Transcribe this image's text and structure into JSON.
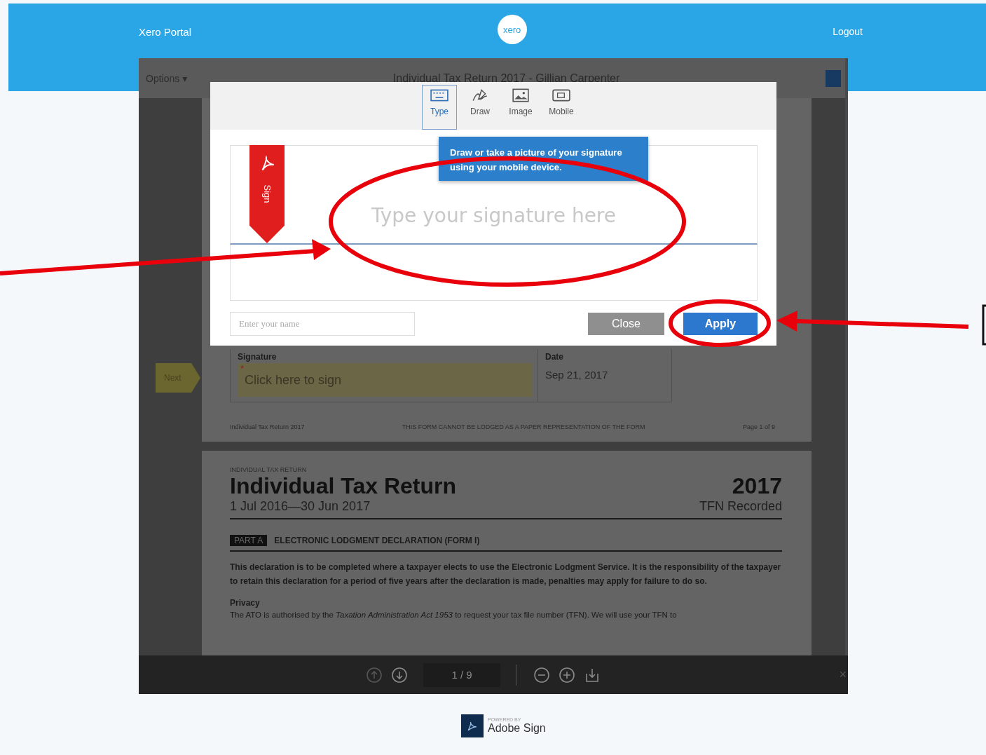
{
  "header": {
    "brand": "Xero Portal",
    "logo_text": "xero",
    "logout": "Logout"
  },
  "viewer": {
    "options_menu": "Options ▾",
    "title": "Individual Tax Return 2017 - Gillian Carpenter",
    "page_one": {
      "next_tag": "Next",
      "signature_label": "Signature",
      "required_mark": "*",
      "signature_placeholder": "Click here to sign",
      "date_label": "Date",
      "date_value": "Sep 21, 2017",
      "footer_left": "Individual Tax Return 2017",
      "footer_center": "THIS FORM CANNOT BE LODGED AS A PAPER REPRESENTATION OF THE FORM",
      "footer_right": "Page 1 of 9"
    },
    "page_two": {
      "eyebrow": "INDIVIDUAL TAX RETURN",
      "title": "Individual Tax Return",
      "year": "2017",
      "period": "1 Jul 2016—30 Jun 2017",
      "tfn_status": "TFN Recorded",
      "part_tag": "PART A",
      "part_title": "ELECTRONIC LODGMENT DECLARATION (FORM I)",
      "paragraph": "This declaration is to be completed where a taxpayer elects to use the Electronic Lodgment Service. It is the responsibility of the taxpayer to retain this declaration for a period of five years after the declaration is made, penalties may apply for failure to do so.",
      "privacy_heading": "Privacy",
      "privacy_text": "The ATO is authorised by the *Taxation Administration Act 1953* to request your tax file number (TFN). We will use your TFN to"
    },
    "controls": {
      "page_indicator": "1 / 9",
      "close": "×"
    }
  },
  "modal": {
    "tabs": [
      {
        "label": "Type",
        "kind": "keyboard",
        "selected": true
      },
      {
        "label": "Draw",
        "kind": "pen",
        "selected": false
      },
      {
        "label": "Image",
        "kind": "image",
        "selected": false
      },
      {
        "label": "Mobile",
        "kind": "mobile",
        "selected": false
      }
    ],
    "tooltip": "Draw or take a picture of your signature using your mobile device.",
    "ribbon_label": "Sign",
    "signature_placeholder": "Type your signature here",
    "name_placeholder": "Enter your name",
    "close_button": "Close",
    "apply_button": "Apply"
  },
  "footer": {
    "powered_by": "POWERED BY",
    "product": "Adobe Sign"
  }
}
